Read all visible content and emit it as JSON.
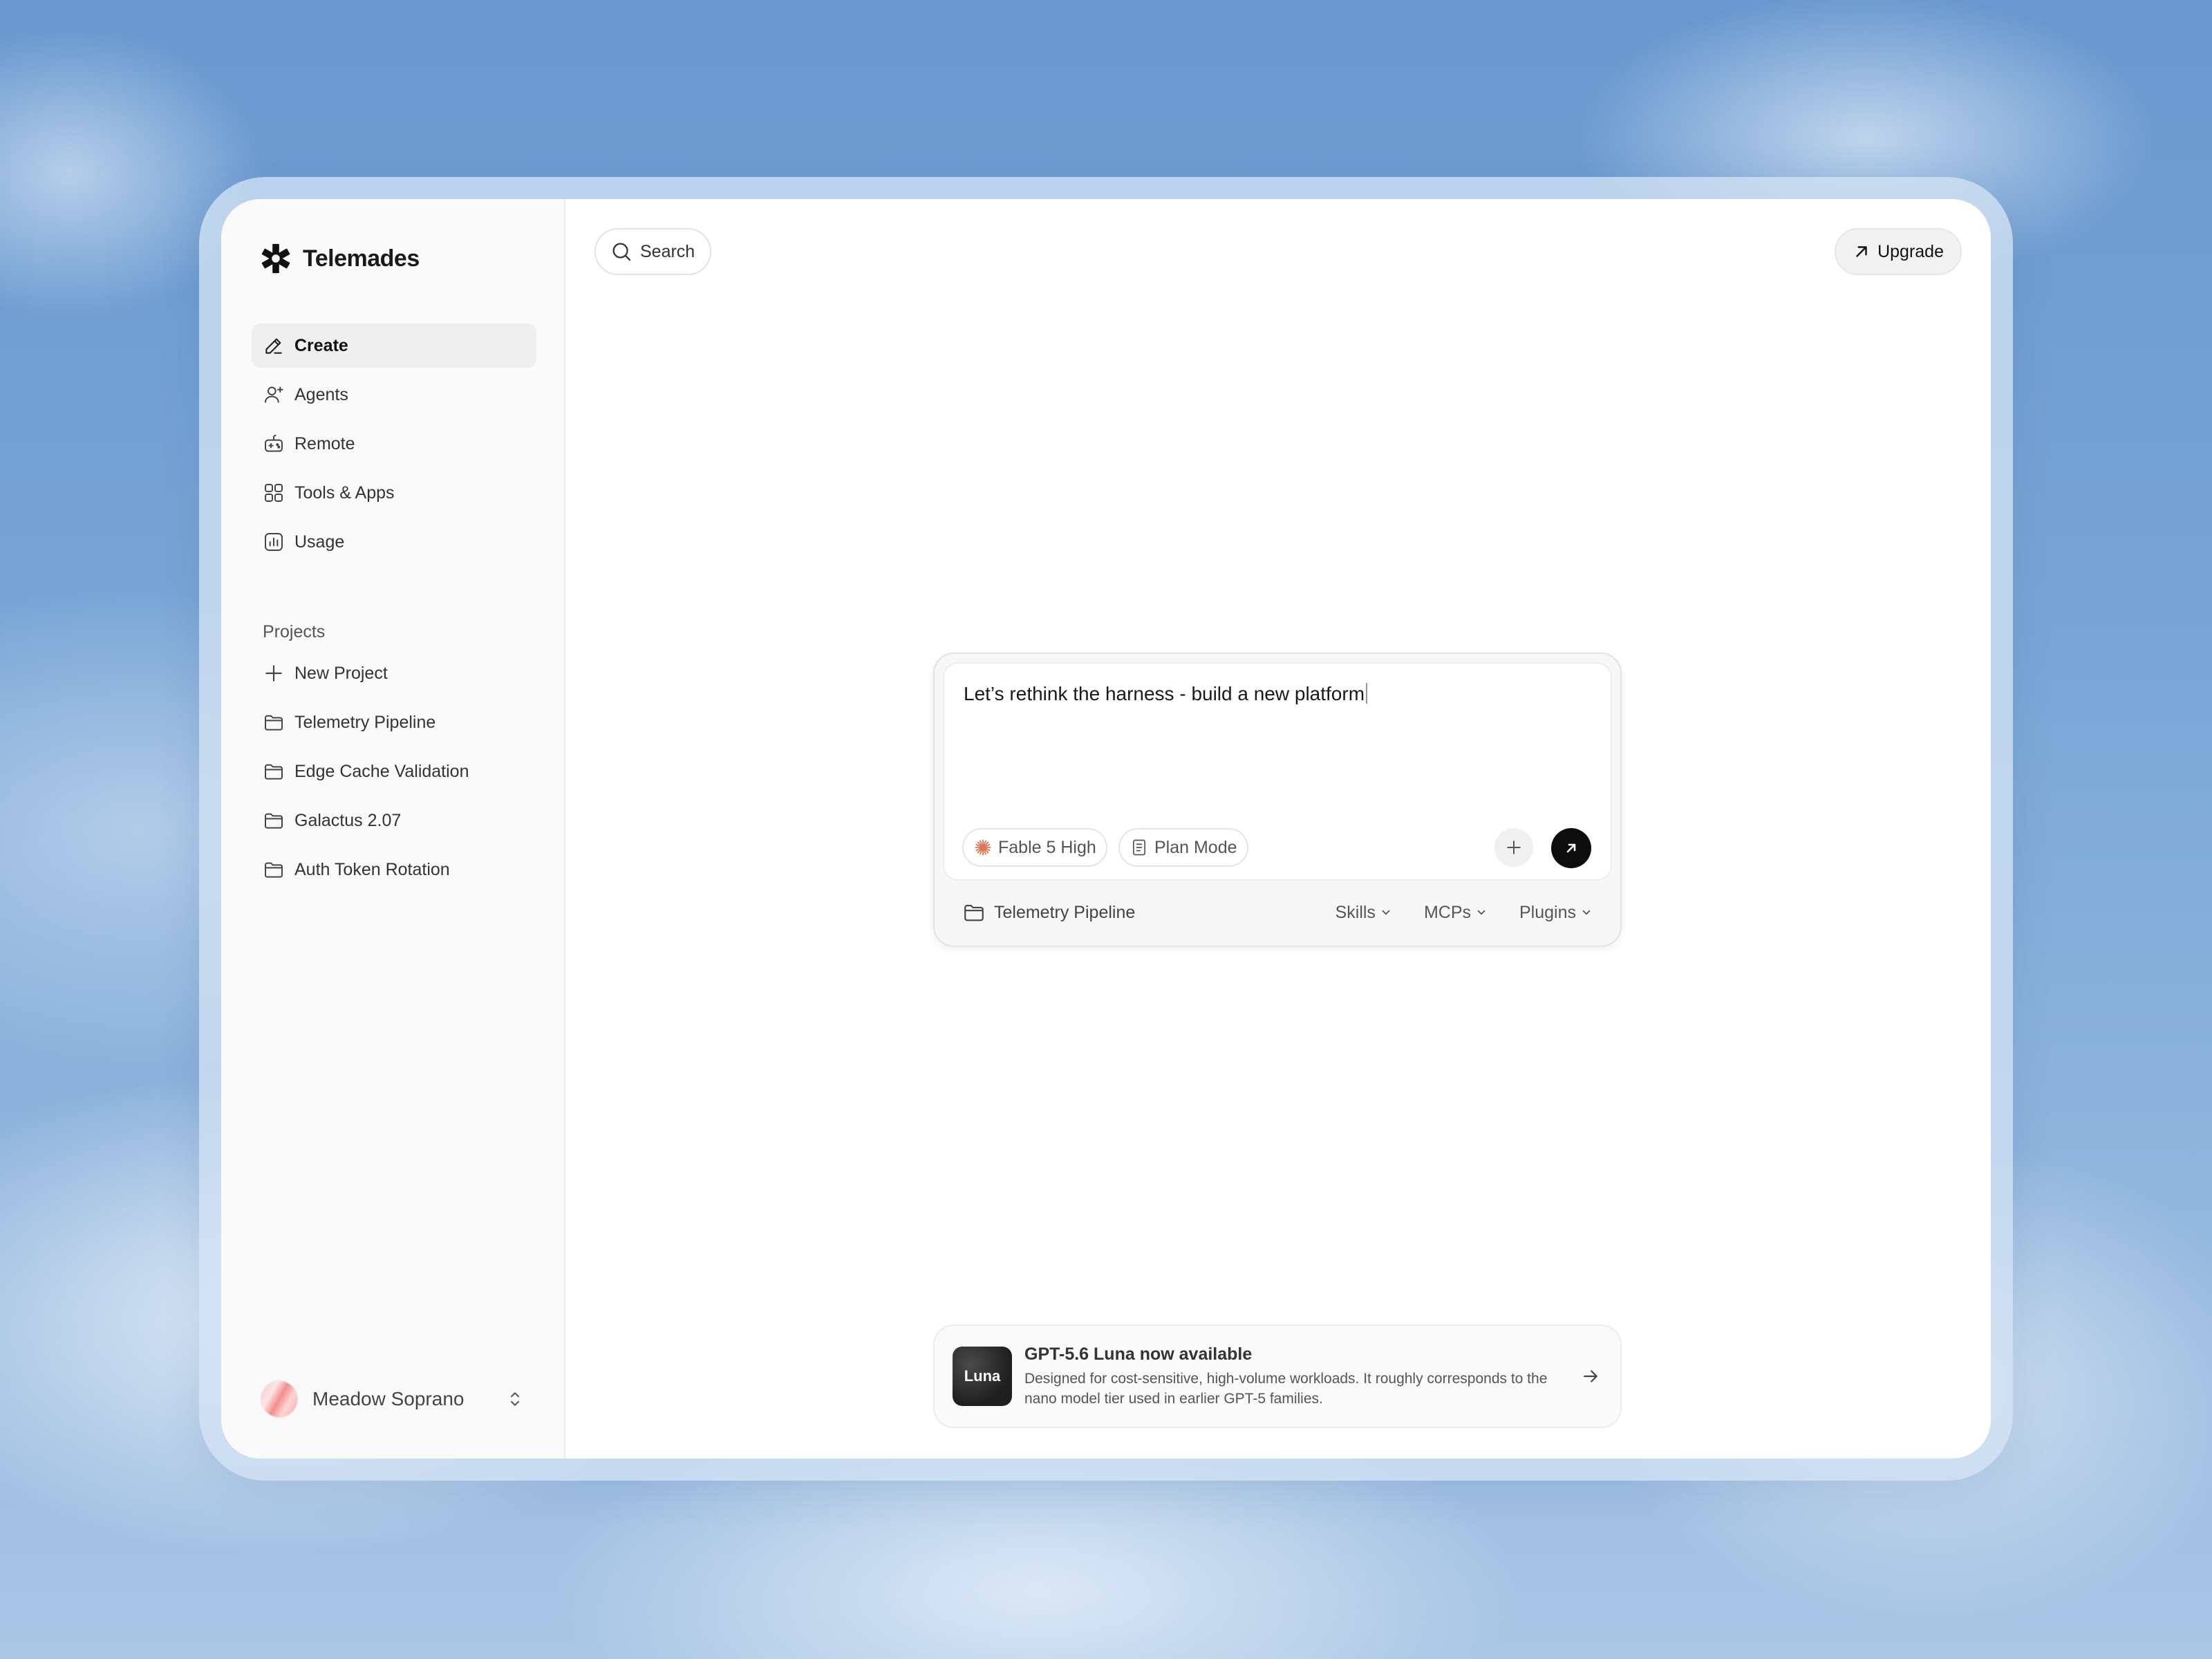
{
  "app": {
    "brand": "Telemades"
  },
  "search": {
    "label": "Search"
  },
  "upgrade": {
    "label": "Upgrade"
  },
  "nav": {
    "items": [
      {
        "label": "Create",
        "icon": "pencil-icon",
        "active": true
      },
      {
        "label": "Agents",
        "icon": "user-plus-icon",
        "active": false
      },
      {
        "label": "Remote",
        "icon": "gamepad-icon",
        "active": false
      },
      {
        "label": "Tools & Apps",
        "icon": "grid-icon",
        "active": false
      },
      {
        "label": "Usage",
        "icon": "bar-chart-icon",
        "active": false
      }
    ]
  },
  "projects": {
    "heading": "Projects",
    "new_label": "New Project",
    "items": [
      {
        "label": "Telemetry Pipeline"
      },
      {
        "label": "Edge Cache Validation"
      },
      {
        "label": "Galactus 2.07"
      },
      {
        "label": "Auth Token Rotation"
      }
    ]
  },
  "user": {
    "name": "Meadow Soprano"
  },
  "composer": {
    "text": "Let’s rethink the harness - build a new platform",
    "model_label": "Fable 5 High",
    "mode_label": "Plan Mode",
    "project_label": "Telemetry Pipeline",
    "menus": [
      "Skills",
      "MCPs",
      "Plugins"
    ]
  },
  "banner": {
    "logo_text": "Luna",
    "title": "GPT-5.6 Luna now available",
    "description": "Designed for cost-sensitive, high-volume workloads. It roughly corresponds to the nano model tier used in earlier GPT-5 families."
  },
  "colors": {
    "accent": "#0d0d0d",
    "active_nav_bg": "#efefef",
    "model_icon": "#d97757"
  }
}
